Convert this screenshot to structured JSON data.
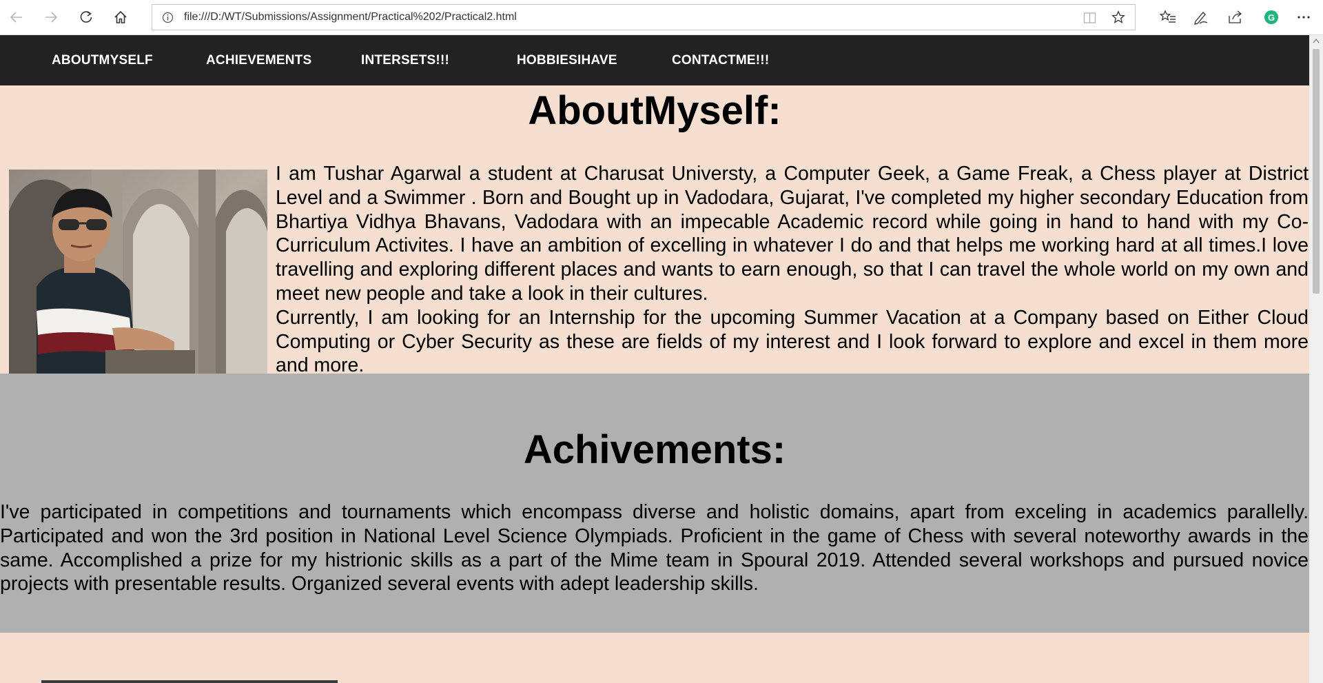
{
  "browser": {
    "url": "file:///D:/WT/Submissions/Assignment/Practical%202/Practical2.html",
    "extension_badge": "G"
  },
  "nav": {
    "items": [
      "ABOUTMYSELF",
      "ACHIEVEMENTS",
      "INTERSETS!!!",
      "HOBBIESIHAVE",
      "CONTACTME!!!"
    ]
  },
  "about": {
    "title": "AboutMyself:",
    "paragraph1": "I am Tushar Agarwal a student at Charusat Universty, a Computer Geek, a Game Freak, a Chess player at District Level and a Swimmer . Born and Bought up in Vadodara, Gujarat, I've completed my higher secondary Education from Bhartiya Vidhya Bhavans, Vadodara with an impecable Academic record while going in hand to hand with my Co-Curriculum Activites. I have an ambition of excelling in whatever I do and that helps me working hard at all times.I love travelling and exploring different places and wants to earn enough, so that I can travel the whole world on my own and meet new people and take a look in their cultures.",
    "paragraph2": "Currently, I am looking for an Internship for the upcoming Summer Vacation at a Company based on Either Cloud Computing or Cyber Security as these are fields of my interest and I look forward to explore and excel in them more and more."
  },
  "achievements": {
    "title": "Achivements:",
    "paragraph": "I've participated in competitions and tournaments which encompass diverse and holistic domains, apart from exceling in academics parallelly. Participated and won the 3rd position in National Level Science Olympiads. Proficient in the game of Chess with several noteworthy awards in the same. Accomplished a prize for my histrionic skills as a part of the Mime team in Spoural 2019. Attended several workshops and pursued novice projects with presentable results. Organized several events with adept leadership skills."
  },
  "colors": {
    "page_bg": "#f5dfd1",
    "nav_bg": "#222222",
    "achievements_bg": "#b0b0b0",
    "extension_green": "#1fb57c"
  }
}
